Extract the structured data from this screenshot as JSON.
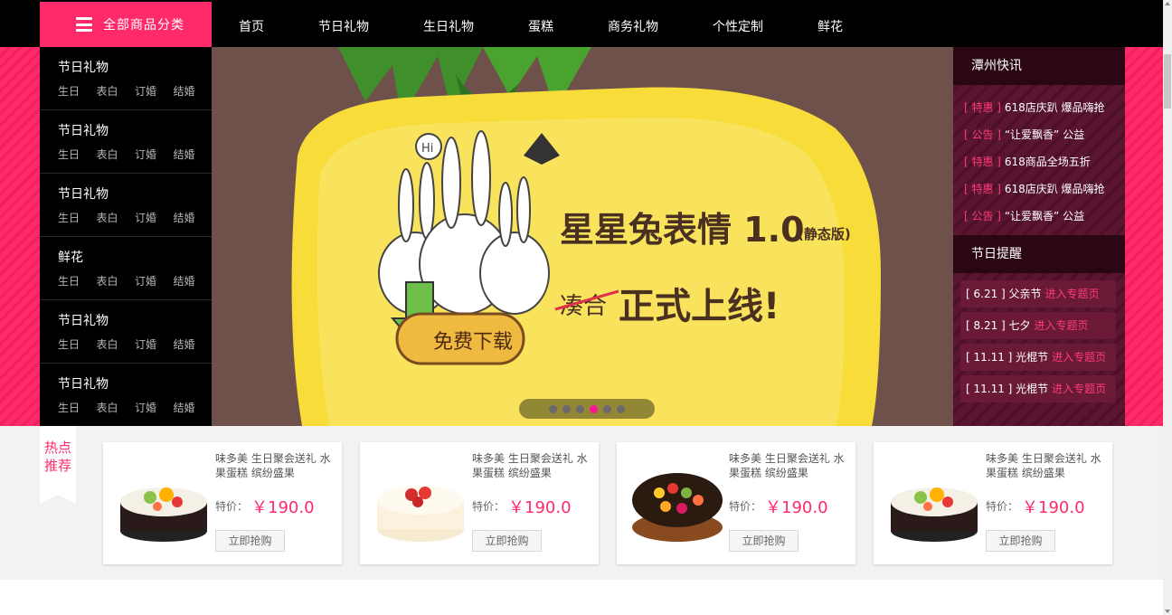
{
  "header": {
    "category_button": "全部商品分类",
    "nav": [
      "首页",
      "节日礼物",
      "生日礼物",
      "蛋糕",
      "商务礼物",
      "个性定制",
      "鲜花"
    ]
  },
  "sidebar": {
    "groups": [
      {
        "title": "节日礼物",
        "subs": [
          "生日",
          "表白",
          "订婚",
          "结婚"
        ]
      },
      {
        "title": "节日礼物",
        "subs": [
          "生日",
          "表白",
          "订婚",
          "结婚"
        ]
      },
      {
        "title": "节日礼物",
        "subs": [
          "生日",
          "表白",
          "订婚",
          "结婚"
        ]
      },
      {
        "title": "鲜花",
        "subs": [
          "生日",
          "表白",
          "订婚",
          "结婚"
        ]
      },
      {
        "title": "节日礼物",
        "subs": [
          "生日",
          "表白",
          "订婚",
          "结婚"
        ]
      },
      {
        "title": "节日礼物",
        "subs": [
          "生日",
          "表白",
          "订婚",
          "结婚"
        ]
      }
    ]
  },
  "banner": {
    "headline": "星星兔表情 1.0",
    "edition": "(静态版)",
    "strike": "凑合",
    "sub": "正式上线!",
    "download": "免费下载",
    "hi": "Hi",
    "slides": 6,
    "active_slide": 4
  },
  "right": {
    "news_title": "潭州快讯",
    "news": [
      {
        "tag": "[ 特惠 ]",
        "text": "618店庆趴 爆品嗨抢"
      },
      {
        "tag": "[ 公告 ]",
        "text": "“让爱飘香” 公益"
      },
      {
        "tag": "[ 特惠 ]",
        "text": "618商品全场五折"
      },
      {
        "tag": "[ 特惠 ]",
        "text": "618店庆趴 爆品嗨抢"
      },
      {
        "tag": "[ 公告 ]",
        "text": "“让爱飘香” 公益"
      }
    ],
    "remind_title": "节日提醒",
    "reminders": [
      {
        "date": "[ 6.21 ] 父亲节",
        "link": "进入专题页"
      },
      {
        "date": "[ 8.21 ] 七夕",
        "link": "进入专题页"
      },
      {
        "date": "[ 11.11 ] 光棍节",
        "link": "进入专题页"
      },
      {
        "date": "[ 11.11 ] 光棍节",
        "link": "进入专题页"
      }
    ]
  },
  "hot": {
    "label": "热点推荐",
    "products": [
      {
        "name": "味多美 生日聚会送礼 水果蛋糕 缤纷盛果",
        "price_label": "特价：",
        "price": "￥190.0",
        "buy": "立即抢购",
        "image": "fruit-cake-dark"
      },
      {
        "name": "味多美 生日聚会送礼 水果蛋糕 缤纷盛果",
        "price_label": "特价：",
        "price": "￥190.0",
        "buy": "立即抢购",
        "image": "strawberry-cream-cake"
      },
      {
        "name": "味多美 生日聚会送礼 水果蛋糕 缤纷盛果",
        "price_label": "特价：",
        "price": "￥190.0",
        "buy": "立即抢购",
        "image": "mixed-fruit-cake"
      },
      {
        "name": "味多美 生日聚会送礼 水果蛋糕 缤纷盛果",
        "price_label": "特价：",
        "price": "￥190.0",
        "buy": "立即抢购",
        "image": "fruit-cake-dark"
      }
    ]
  },
  "colors": {
    "accent": "#ff2a6a",
    "banner_bg": "#6e514b",
    "banner_yellow": "#f7dc3a"
  }
}
